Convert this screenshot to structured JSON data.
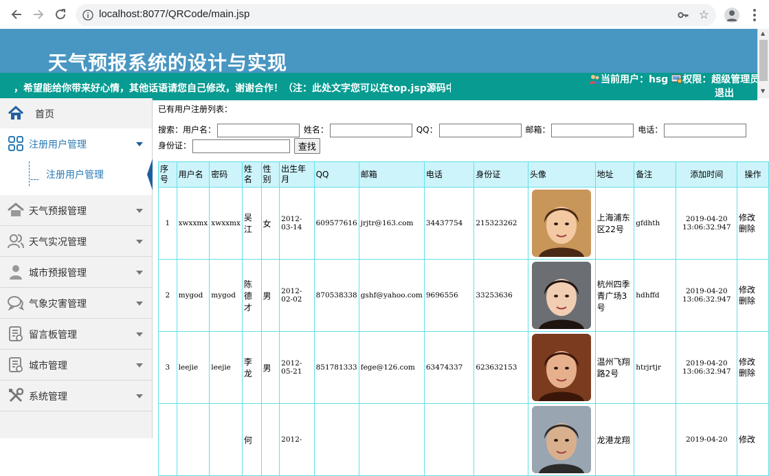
{
  "browser": {
    "url": "localhost:8077/QRCode/main.jsp"
  },
  "header": {
    "title": "天气预报系统的设计与实现",
    "marquee": "迎，希望能给你带来好心情，其他话语请您自己修改，谢谢合作！（注：此处文字您可以在top.jsp源码中修改）",
    "current_user_label": "当前用户：",
    "current_user": "hsg",
    "role_label": "权限：",
    "role": "超级管理员",
    "logout": "退出"
  },
  "sidebar": {
    "items": [
      {
        "label": "首页",
        "icon": "home-icon"
      },
      {
        "label": "注册用户管理",
        "icon": "grid-icon"
      },
      {
        "label": "天气预报管理",
        "icon": "house-icon"
      },
      {
        "label": "天气实况管理",
        "icon": "users-icon"
      },
      {
        "label": "城市预报管理",
        "icon": "person-icon"
      },
      {
        "label": "气象灾害管理",
        "icon": "chat-icon"
      },
      {
        "label": "留言板管理",
        "icon": "document-icon"
      },
      {
        "label": "城市管理",
        "icon": "document-icon"
      },
      {
        "label": "系统管理",
        "icon": "tools-icon"
      }
    ],
    "subitem": "注册用户管理"
  },
  "main": {
    "list_title": "已有用户注册列表：",
    "search": {
      "label": "搜索：",
      "username_label": "用户名：",
      "name_label": "姓名：",
      "qq_label": "QQ：",
      "email_label": "邮箱：",
      "phone_label": "电话：",
      "idcard_label": "身份证：",
      "button": "查找"
    },
    "columns": [
      "序号",
      "用户名",
      "密码",
      "姓名",
      "性别",
      "出生年月",
      "QQ",
      "邮箱",
      "电话",
      "身份证",
      "头像",
      "地址",
      "备注",
      "添加时间",
      "操作"
    ],
    "rows": [
      {
        "no": "1",
        "username": "xwxxmx",
        "password": "xwxxmx",
        "name": "吴江",
        "gender": "女",
        "birth": "2012-03-14",
        "qq": "609577616",
        "email": "jrjtr@163.com",
        "phone": "34437754",
        "idcard": "215323262",
        "address": "上海浦东区22号",
        "remark": "gfdhth",
        "added": "2019-04-20 13:06:32.947",
        "edit": "修改",
        "delete": "删除"
      },
      {
        "no": "2",
        "username": "mygod",
        "password": "mygod",
        "name": "陈德才",
        "gender": "男",
        "birth": "2012-02-02",
        "qq": "870538338",
        "email": "gshf@yahoo.com",
        "phone": "9696556",
        "idcard": "33253636",
        "address": "杭州四季青广场3号",
        "remark": "hdhffd",
        "added": "2019-04-20 13:06:32.947",
        "edit": "修改",
        "delete": "删除"
      },
      {
        "no": "3",
        "username": "leejie",
        "password": "leejie",
        "name": "李龙",
        "gender": "男",
        "birth": "2012-05-21",
        "qq": "851781333",
        "email": "fege@126.com",
        "phone": "63474337",
        "idcard": "623632153",
        "address": "温州飞翔路2号",
        "remark": "htrjrtjr",
        "added": "2019-04-20 13:06:32.947",
        "edit": "修改",
        "delete": "删除"
      },
      {
        "no": "",
        "username": "",
        "password": "",
        "name": "何",
        "gender": "",
        "birth": "2012-",
        "qq": "",
        "email": "",
        "phone": "",
        "idcard": "",
        "address": "龙港龙翔",
        "remark": "",
        "added": "2019-04-20",
        "edit": "修改",
        "delete": ""
      }
    ]
  },
  "colors": {
    "header_blue": "#4896c2",
    "header_teal": "#079b91",
    "table_border": "#5fe0e8",
    "table_header_bg": "#cdf4fb",
    "sidebar_active": "#2a7ab5"
  }
}
